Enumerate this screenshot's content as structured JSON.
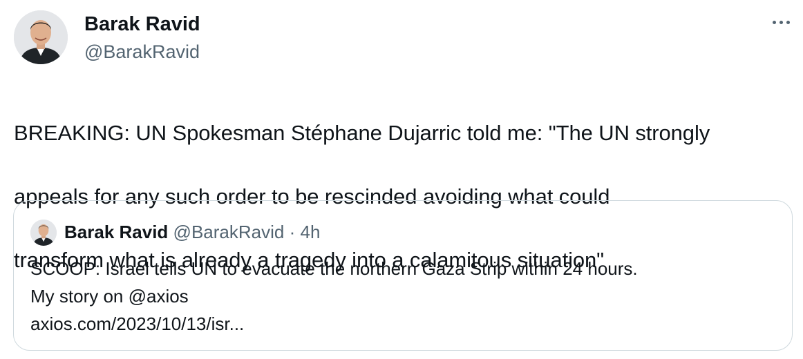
{
  "tweet": {
    "author": {
      "name": "Barak Ravid",
      "handle": "@BarakRavid"
    },
    "text_lines": [
      "BREAKING: UN Spokesman Stéphane Dujarric told me: \"The UN strongly",
      "appeals for any such order to be rescinded avoiding what could",
      "transform what is already a tragedy into a calamitous situation\""
    ],
    "more_icon": "more-horizontal-icon"
  },
  "quoted_tweet": {
    "author": {
      "name": "Barak Ravid",
      "handle": "@BarakRavid",
      "separator": "·",
      "time": "4h"
    },
    "text_lines": [
      "SCOOP: Israel tells UN to evacuate the northern Gaza Strip within 24 hours.",
      "My story on @axios",
      "axios.com/2023/10/13/isr..."
    ]
  },
  "colors": {
    "text": "#0f1419",
    "secondary_text": "#536471",
    "border": "#cfd9de",
    "background": "#ffffff"
  }
}
